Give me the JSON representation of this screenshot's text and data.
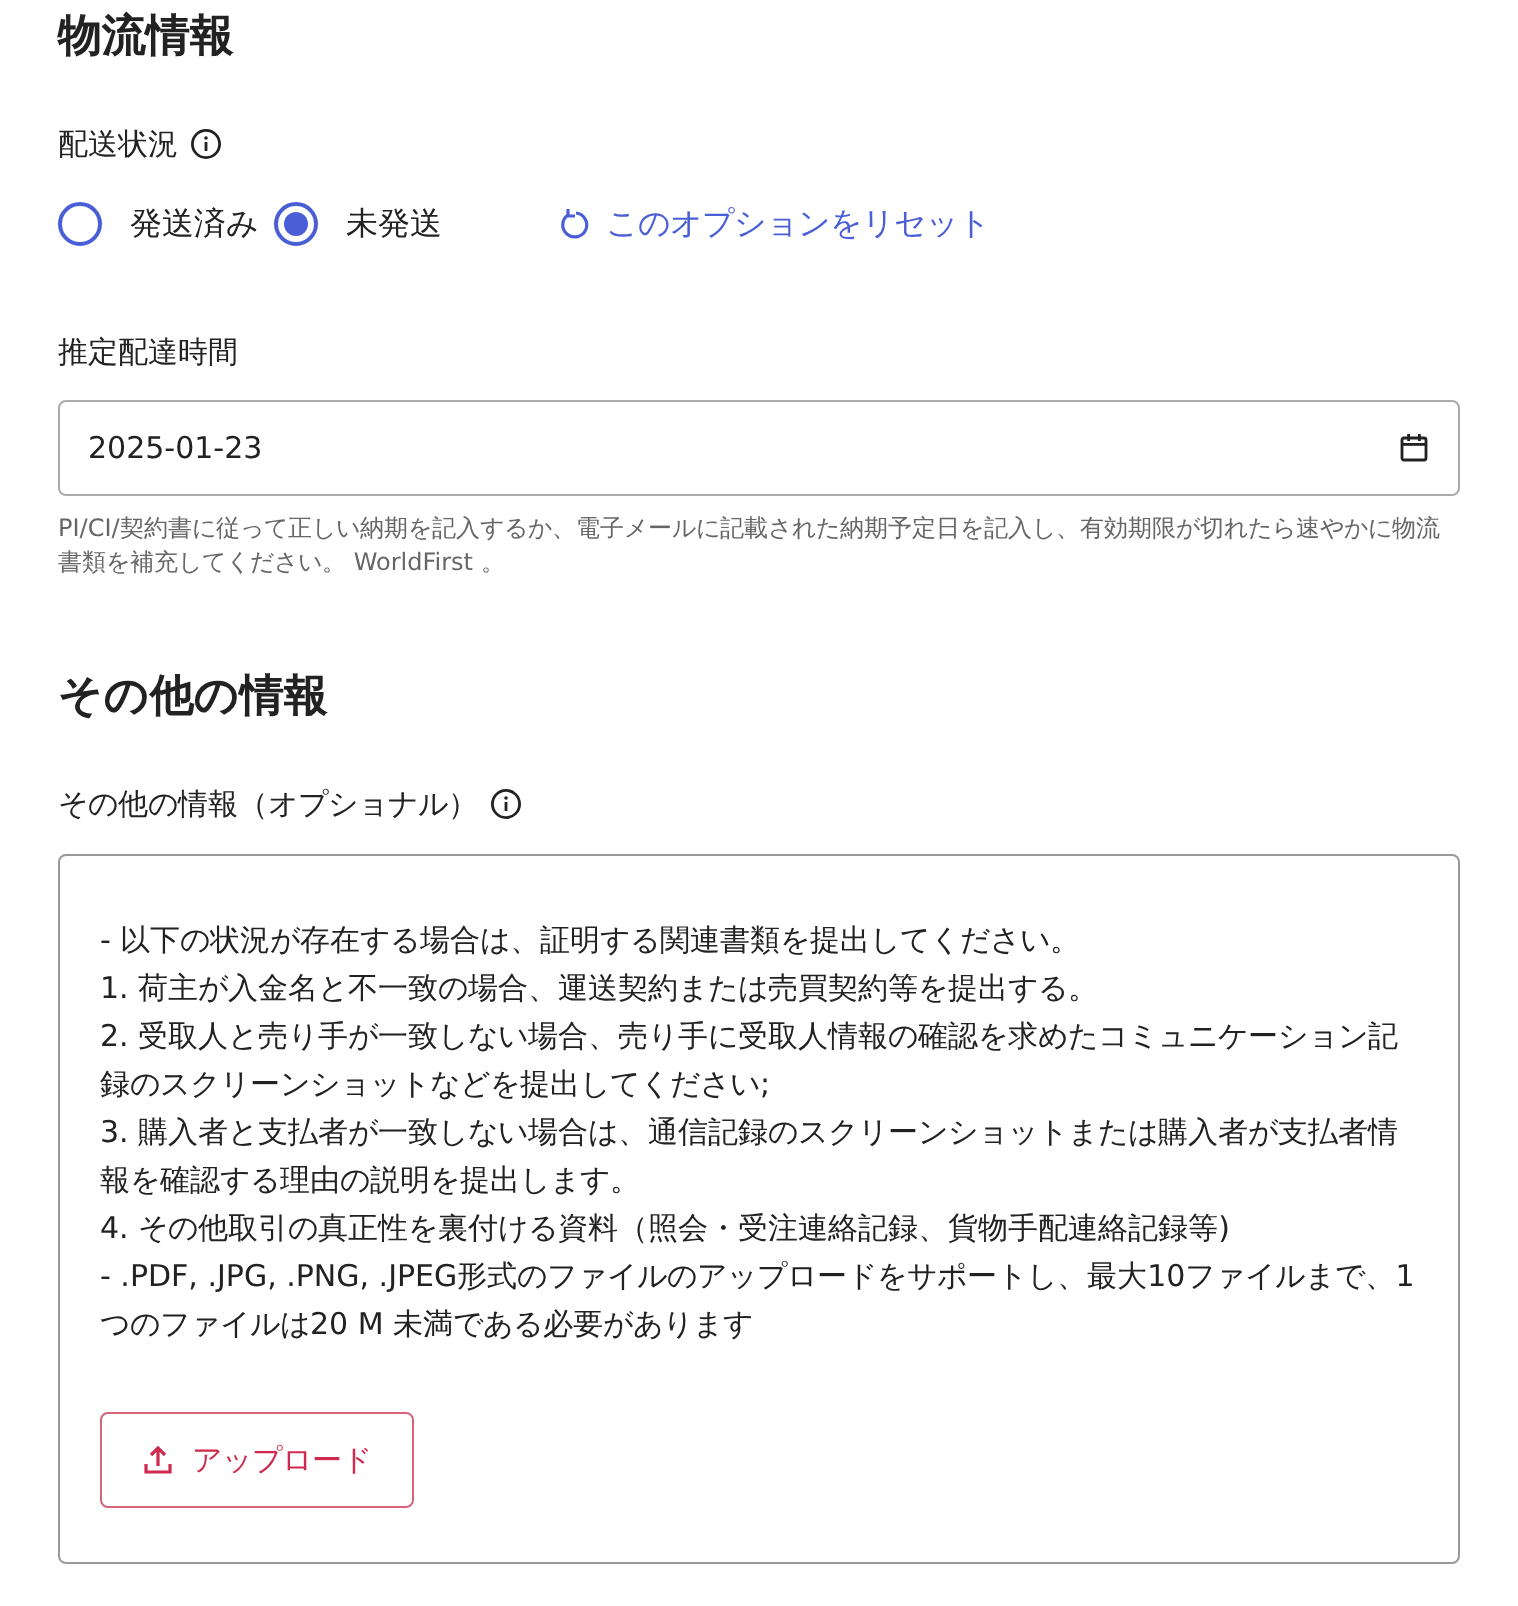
{
  "logistics": {
    "title": "物流情報",
    "status_label": "配送状況",
    "radios": [
      {
        "label": "発送済み",
        "selected": false
      },
      {
        "label": "未発送",
        "selected": true
      }
    ],
    "reset_link": "このオプションをリセット",
    "date_label": "推定配達時間",
    "date_value": "2025-01-23",
    "help": "PI/CI/契約書に従って正しい納期を記入するか、電子メールに記載された納期予定日を記入し、有効期限が切れたら速やかに物流書類を補充してください。 WorldFirst 。"
  },
  "other": {
    "title": "その他の情報",
    "label": "その他の情報（オプショナル）",
    "lines": [
      "- 以下の状況が存在する場合は、証明する関連書類を提出してください。",
      "1. 荷主が入金名と不一致の場合、運送契約または売買契約等を提出する。",
      "2. 受取人と売り手が一致しない場合、売り手に受取人情報の確認を求めたコミュニケーション記録のスクリーンショットなどを提出してください;",
      "3. 購入者と支払者が一致しない場合は、通信記録のスクリーンショットまたは購入者が支払者情報を確認する理由の説明を提出します。",
      "4. その他取引の真正性を裏付ける資料（照会・受注連絡記録、貨物手配連絡記録等)",
      "- .PDF, .JPG, .PNG, .JPEG形式のファイルのアップロードをサポートし、最大10ファイルまで、1 つのファイルは20 M 未満である必要があります"
    ],
    "upload_button": "アップロード"
  }
}
